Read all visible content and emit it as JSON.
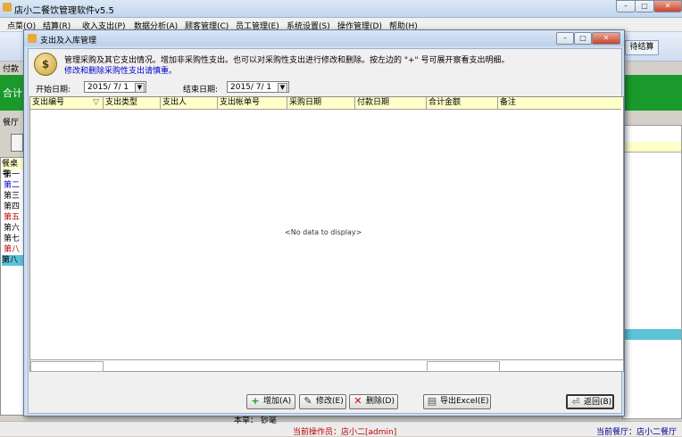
{
  "app": {
    "title": "店小二餐饮管理软件v5.5",
    "window_controls": [
      "–",
      "□",
      "✕"
    ]
  },
  "menu": [
    "点菜(O)",
    "结算(R)",
    "收入支出(P)",
    "数据分析(A)",
    "顾客管理(C)",
    "员工管理(E)",
    "系统设置(S)",
    "操作管理(D)",
    "帮助(H)"
  ],
  "background": {
    "left_label_1": "付款",
    "left_label_2": "合计",
    "left_label_3": "餐厅",
    "right_button": "待结算",
    "left_list_header": "餐桌号",
    "left_list": [
      "第一",
      "第二",
      "第三",
      "第四",
      "第五",
      "第六",
      "第七",
      "第八",
      "第八"
    ]
  },
  "dialog": {
    "title": "支出及入库管理",
    "description_line1": "管理采购及其它支出情况。增加非采购性支出。也可以对采购性支出进行修改和删除。按左边的 \"+\" 号可展开察看支出明细。",
    "description_line2": "修改和删除采购性支出请慎重。",
    "start_date_label": "开始日期:",
    "start_date_value": "2015/ 7/ 1",
    "end_date_label": "结束日期:",
    "end_date_value": "2015/ 7/ 1",
    "columns": [
      "支出编号",
      "支出类型",
      "支出人",
      "支出帐单号",
      "采购日期",
      "付款日期",
      "合计金额",
      "备注"
    ],
    "no_data_text": "<No data to display>",
    "footer_count": "0",
    "buttons": {
      "add": "增加(A)",
      "modify": "修改(E)",
      "delete": "删除(D)",
      "export": "导出Excel(E)",
      "back": "返回(B)"
    }
  },
  "statusbar": {
    "operator": "当前操作员：店小二[admin]",
    "canteen": "当前餐厅：店小二餐厅",
    "bottom_fragment": "本草：    钞毫"
  },
  "colors": {
    "accent_green": "#1a9a2a",
    "grid_header_bg": "#ffffc8",
    "status_red": "#c00000",
    "link_blue": "#0000c8"
  }
}
